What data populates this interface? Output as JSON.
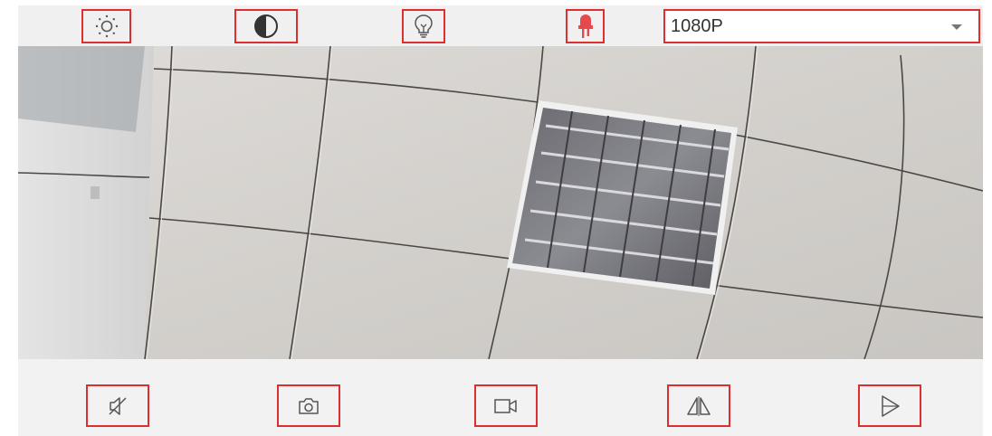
{
  "toolbar_top": {
    "buttons": [
      {
        "icon": "brightness-sun-icon"
      },
      {
        "icon": "contrast-icon"
      },
      {
        "icon": "light-bulb-icon"
      },
      {
        "icon": "infrared-led-icon",
        "color": "#e5484d"
      }
    ],
    "resolution": {
      "selected": "1080P"
    }
  },
  "toolbar_bottom": {
    "buttons": [
      {
        "icon": "mute-icon"
      },
      {
        "icon": "camera-snapshot-icon"
      },
      {
        "icon": "video-record-icon"
      },
      {
        "icon": "mirror-flip-icon"
      },
      {
        "icon": "rotate-flip-icon"
      }
    ]
  },
  "colors": {
    "highlight_border": "#dc2f2f",
    "ir_led": "#e5484d",
    "toolbar_bg": "#f0f0f0"
  }
}
